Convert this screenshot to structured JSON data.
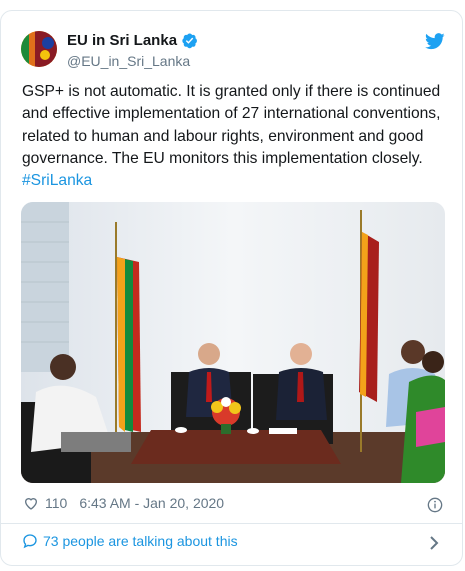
{
  "tweet": {
    "author_name": "EU in Sri Lanka",
    "handle": "@EU_in_Sri_Lanka",
    "text_main": "GSP+ is not automatic. It is granted only if there is continued and effective implementation of 27 international conventions, related to human and labour rights, environment and good governance. The EU monitors this implementation closely. ",
    "hashtag": "#SriLanka",
    "likes": "110",
    "timestamp": "6:43 AM - Jan 20, 2020",
    "talking": "73 people are talking about this"
  },
  "colors": {
    "link": "#1b95e0",
    "secondary_text": "#657786",
    "border": "#e1e8ed",
    "verified": "#1da1f2"
  },
  "icons": [
    "avatar",
    "verified-badge-icon",
    "twitter-bird-icon",
    "heart-icon",
    "info-icon",
    "speech-bubble-icon",
    "chevron-right-icon"
  ]
}
